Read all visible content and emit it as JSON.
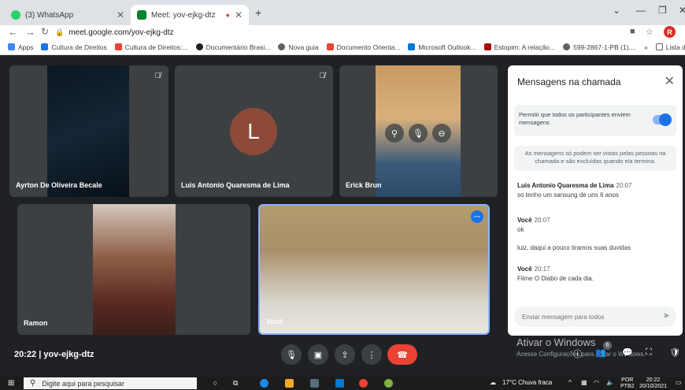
{
  "browser": {
    "tabs": [
      {
        "title": "(3) WhatsApp",
        "color": "#25d366"
      },
      {
        "title": "Meet: yov-ejkg-dtz",
        "color": "#00832d"
      }
    ],
    "new_tab": "+",
    "url": "meet.google.com/yov-ejkg-dtz",
    "profile_initial": "R",
    "bookmarks": [
      "Apps",
      "Cultura de Direitos",
      "Cultura de Direitos:...",
      "Documentário Brasi...",
      "Nova guia",
      "Documento Orienta...",
      "Microsoft Outlook...",
      "Estopim: A relação...",
      "599-2867-1-PB (1)....",
      "»",
      "Lista de leitura"
    ]
  },
  "meet": {
    "participants": [
      {
        "name": "Ayrton De Oliveira Becale",
        "muted": true
      },
      {
        "name": "Luis Antonio Quaresma de Lima",
        "muted": true,
        "initial": "L"
      },
      {
        "name": "Erick Brun",
        "muted": false
      },
      {
        "name": "Ramon",
        "muted": false
      },
      {
        "name": "Você",
        "muted": false
      }
    ],
    "meeting_time": "20:22",
    "meeting_code": "yov-ejkg-dtz",
    "time_and_code": "20:22  |  yov-ejkg-dtz",
    "people_count": "6"
  },
  "chat": {
    "title": "Mensagens na chamada",
    "allow_text": "Permitir que todos os participantes enviem mensagens",
    "allow_enabled": true,
    "note": "As mensagens só podem ser vistas pelas pessoas na chamada e são excluídas quando ela termina.",
    "messages": [
      {
        "sender": "Luis Antonio Quaresma de Lima",
        "time": "20:07",
        "lines": [
          "so tenho um sansung de uns 6 anos"
        ]
      },
      {
        "sender": "Você",
        "time": "20:07",
        "lines": [
          "ok",
          "luiz, daqui a pouco tiramos suas duvidas"
        ]
      },
      {
        "sender": "Você",
        "time": "20:17",
        "lines": [
          "Filme O Diabo de cada dia."
        ]
      }
    ],
    "input_placeholder": "Enviar mensagem para todos"
  },
  "windows": {
    "activate_title": "Ativar o Windows",
    "activate_sub": "Acesse Configurações para ativar o Windows.",
    "search_placeholder": "Digite aqui para pesquisar",
    "weather": "17°C  Chuva fraca",
    "lang": "POR",
    "lang2": "PTB2",
    "clock_time": "20:22",
    "clock_date": "20/10/2021"
  },
  "colors": {
    "accent": "#1a73e8",
    "end_call": "#ea4335",
    "avatar_l": "#8d4a38"
  }
}
